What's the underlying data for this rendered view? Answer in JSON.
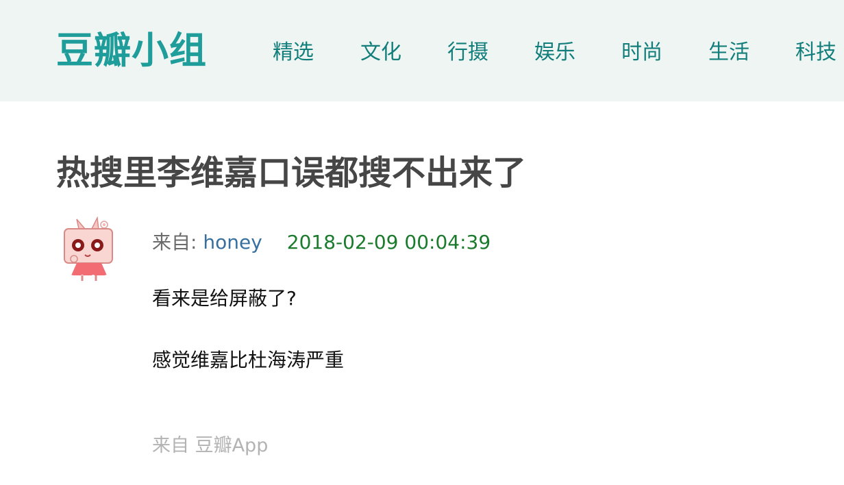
{
  "header": {
    "logo": "豆瓣小组",
    "nav": [
      "精选",
      "文化",
      "行摄",
      "娱乐",
      "时尚",
      "生活",
      "科技"
    ]
  },
  "post": {
    "title": "热搜里李维嘉口误都搜不出来了",
    "from_label": "来自: ",
    "author": "honey",
    "timestamp": "2018-02-09 00:04:39",
    "paragraphs": [
      "看来是给屏蔽了?",
      "感觉维嘉比杜海涛严重"
    ],
    "source": "来自 豆瓣App"
  },
  "colors": {
    "header_bg": "#eff5f3",
    "logo": "#1f9d9a",
    "nav_link": "#127e7b",
    "author_link": "#37709f",
    "timestamp": "#1b7a2c"
  }
}
